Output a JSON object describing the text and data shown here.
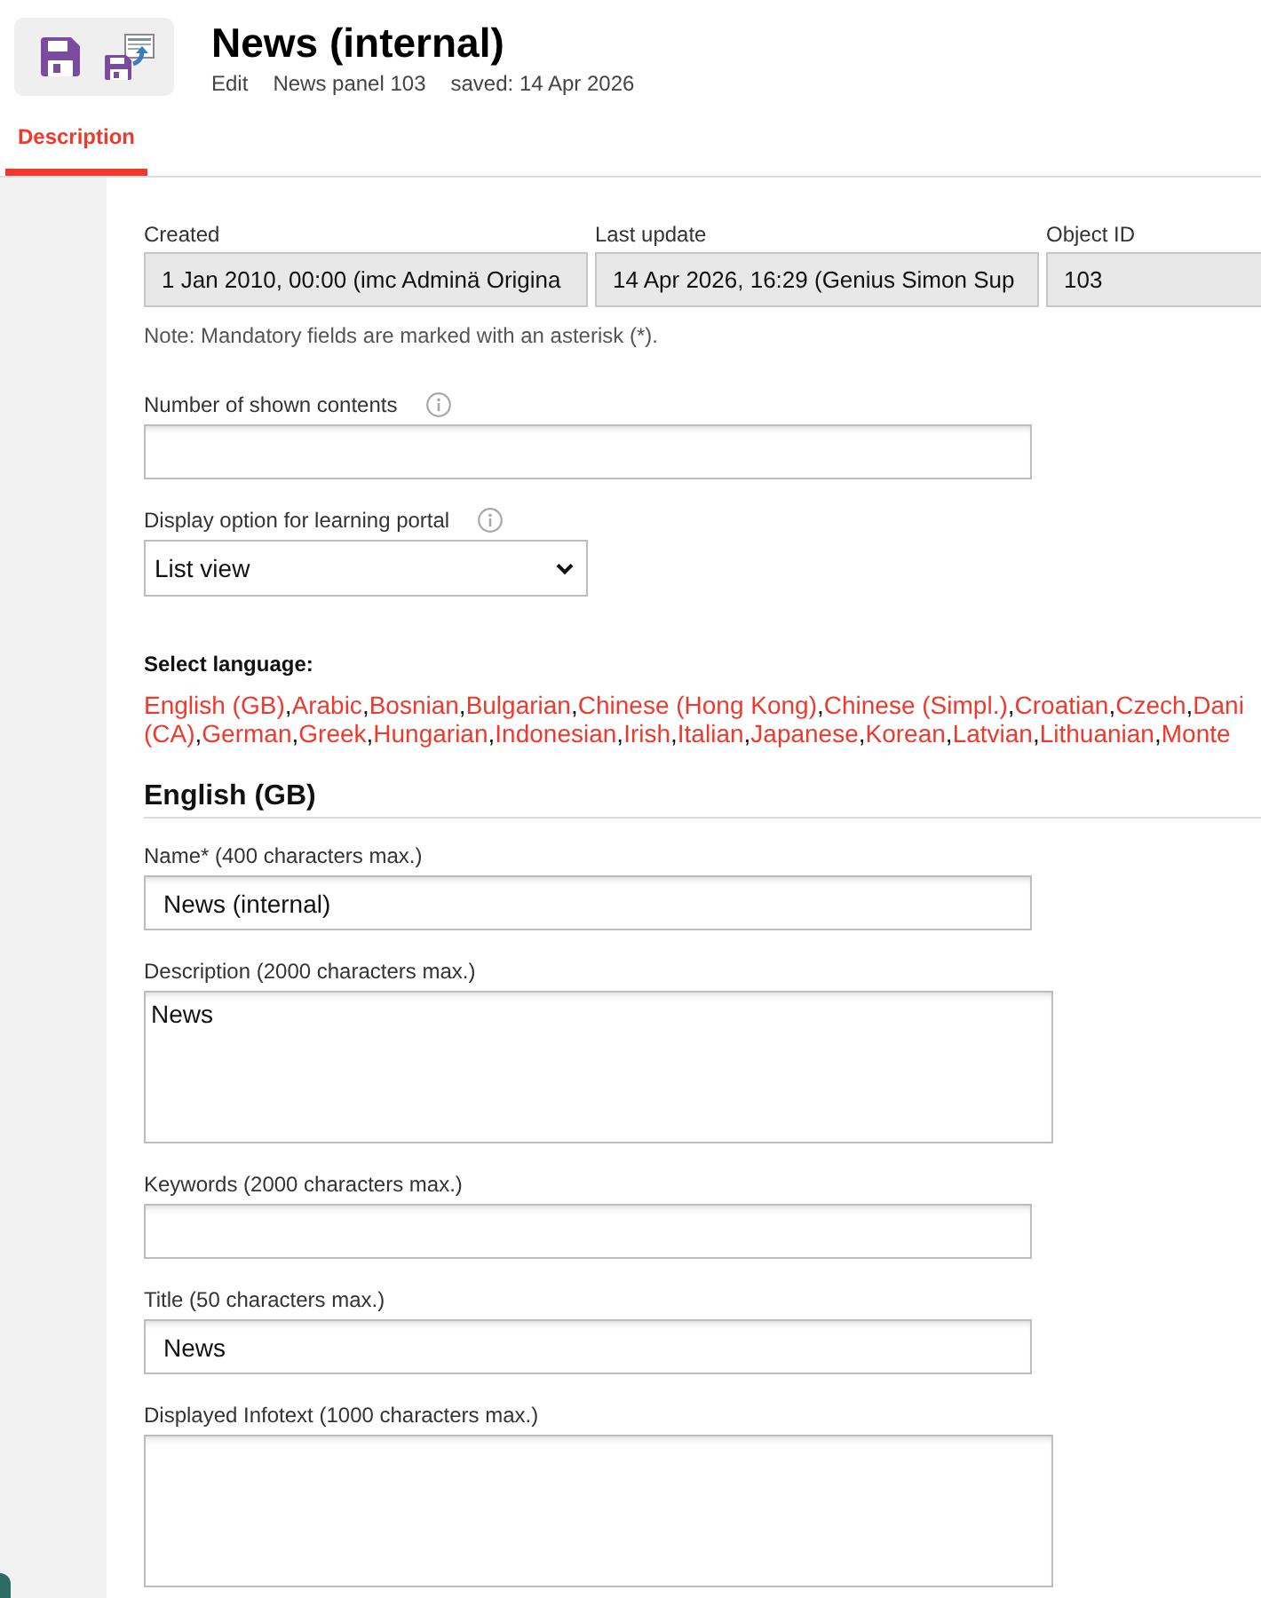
{
  "toolbar": [
    {
      "kind": "save"
    },
    {
      "kind": "save_copy"
    }
  ],
  "header": {
    "title": "News (internal)",
    "meta": [
      "Edit",
      "News panel 103",
      "saved: 14 Apr 2026"
    ]
  },
  "tabs": [
    {
      "label": "Description",
      "selected": true
    }
  ],
  "info_fields": [
    {
      "label": "Created",
      "value": "1 Jan 2010, 00:00 (imc Adminä Origina"
    },
    {
      "label": "Last update",
      "value": "14 Apr 2026, 16:29 (Genius Simon Sup"
    },
    {
      "label": "Object ID",
      "value": "103"
    }
  ],
  "note": "Note: Mandatory fields are marked with an asterisk (*).",
  "settings": [
    {
      "kind": "input",
      "label": "Number of shown contents",
      "info": true
    },
    {
      "kind": "select",
      "label": "Display option for learning portal",
      "info": true,
      "value": "List view"
    }
  ],
  "language_selector": {
    "label": "Select language:",
    "separator": ",",
    "lines": [
      [
        "English (GB)",
        "Arabic",
        "Bosnian",
        "Bulgarian",
        "Chinese (Hong Kong)",
        "Chinese (Simpl.)",
        "Croatian",
        "Czech",
        "Dani"
      ],
      [
        "(CA)",
        "German",
        "Greek",
        "Hungarian",
        "Indonesian",
        "Irish",
        "Italian",
        "Japanese",
        "Korean",
        "Latvian",
        "Lithuanian",
        "Monte"
      ]
    ]
  },
  "language_section": {
    "heading": "English (GB)",
    "fields": [
      {
        "kind": "input",
        "label": "Name* (400 characters max.)",
        "value": "News (internal)"
      },
      {
        "kind": "textarea",
        "label": "Description (2000 characters max.)",
        "value": "News"
      },
      {
        "kind": "input",
        "label": "Keywords (2000 characters max.)"
      },
      {
        "kind": "input",
        "label": "Title (50 characters max.)",
        "value": "News"
      },
      {
        "kind": "textarea",
        "label": "Displayed Infotext (1000 characters max.)"
      }
    ]
  }
}
